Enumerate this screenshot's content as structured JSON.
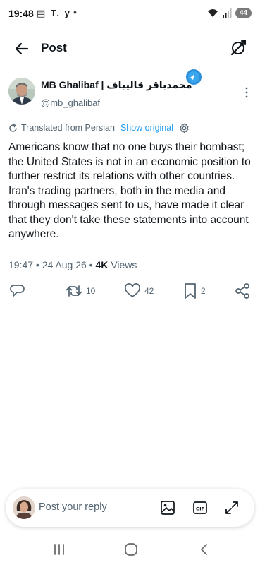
{
  "status_bar": {
    "time": "19:48",
    "app_icons": "▤ T. y",
    "dot": "•",
    "battery": "44"
  },
  "header": {
    "title": "Post"
  },
  "post": {
    "author": {
      "display_name": "MB Ghalibaf | محمدباقر قالیباف",
      "handle": "@mb_ghalibaf"
    },
    "translation": {
      "label": "Translated from Persian",
      "show_original": "Show original"
    },
    "text": "Americans know that no one buys their bombast; the United States is not in an economic position to further restrict its relations with other countries.\nIran's trading partners, both in the media and through messages sent to us, have made it clear that they don't take these statements into account anywhere.",
    "timestamp": "19:47 • 24 Aug 26 • ",
    "views_count": "4K",
    "views_label": " Views",
    "stats": {
      "reposts": "10",
      "likes": "42",
      "bookmarks": "2"
    }
  },
  "reply_bar": {
    "placeholder": "Post your reply"
  },
  "colors": {
    "accent": "#1d9bf0",
    "text": "#0f1419",
    "secondary": "#536471"
  }
}
